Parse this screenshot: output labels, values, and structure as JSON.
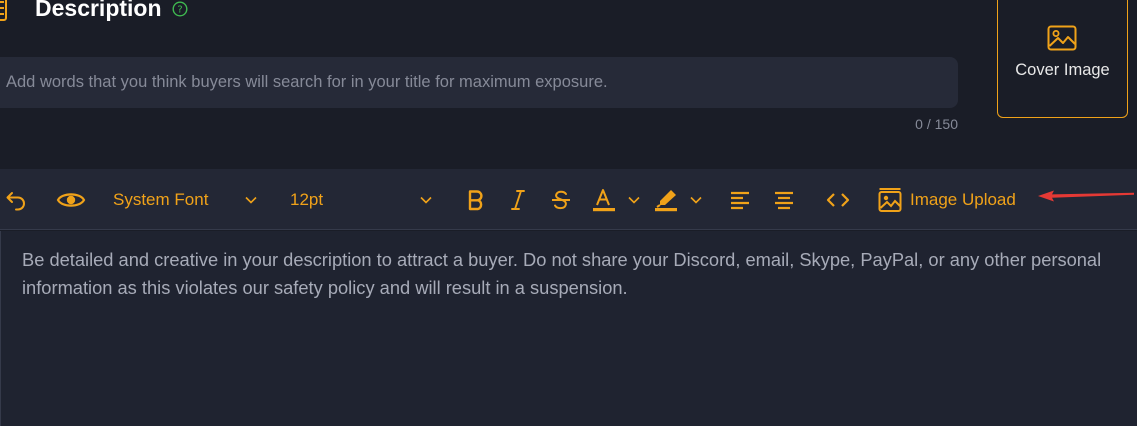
{
  "header": {
    "title": "Description",
    "help_icon": "question-circle-icon"
  },
  "tags_input": {
    "value": "",
    "placeholder": "Add words that you think buyers will search for in your title for maximum exposure.",
    "counter": "0 / 150"
  },
  "cover": {
    "label": "Cover Image",
    "icon": "image-icon"
  },
  "toolbar": {
    "font_family": "System Font",
    "font_size": "12pt",
    "image_upload_label": "Image Upload",
    "accent_color": "#f0a219"
  },
  "editor": {
    "placeholder": "Be detailed and creative in your description to attract a buyer. Do not share your Discord, email, Skype, PayPal, or any other personal information as this violates our safety policy and will result in a suspension."
  },
  "annotation": {
    "arrow_color": "#e53935"
  }
}
